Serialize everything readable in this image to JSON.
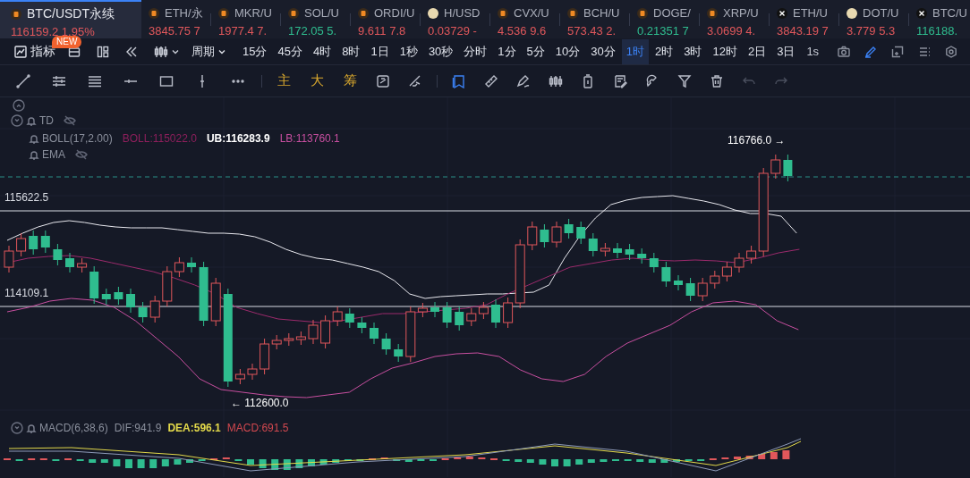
{
  "tabs": [
    {
      "symbol": "BTC/USDT永续",
      "quote": "116159.2 1.95%",
      "color": "#e0575b",
      "kind": "coin",
      "selected": true
    },
    {
      "symbol": "ETH/永",
      "quote": "3845.75 7",
      "color": "#e0575b",
      "kind": "coin",
      "selected": false
    },
    {
      "symbol": "MKR/U",
      "quote": "1977.4 7.",
      "color": "#e0575b",
      "kind": "coin",
      "selected": false
    },
    {
      "symbol": "SOL/U",
      "quote": "172.05 5.",
      "color": "#2fbd8f",
      "kind": "coin",
      "selected": false
    },
    {
      "symbol": "ORDI/U",
      "quote": "9.611 7.8",
      "color": "#e0575b",
      "kind": "coin",
      "selected": false
    },
    {
      "symbol": "H/USD",
      "quote": "0.03729 -",
      "color": "#e0575b",
      "kind": "light",
      "selected": false
    },
    {
      "symbol": "CVX/U",
      "quote": "4.536 9.6",
      "color": "#e0575b",
      "kind": "coin",
      "selected": false
    },
    {
      "symbol": "BCH/U",
      "quote": "573.43 2.",
      "color": "#e0575b",
      "kind": "coin",
      "selected": false
    },
    {
      "symbol": "DOGE/",
      "quote": "0.21351 7",
      "color": "#2fbd8f",
      "kind": "coin",
      "selected": false
    },
    {
      "symbol": "XRP/U",
      "quote": "3.0699 4.",
      "color": "#e0575b",
      "kind": "coin",
      "selected": false
    },
    {
      "symbol": "ETH/U",
      "quote": "3843.19 7",
      "color": "#e0575b",
      "kind": "cross",
      "selected": false
    },
    {
      "symbol": "DOT/U",
      "quote": "3.779 5.3",
      "color": "#e0575b",
      "kind": "light",
      "selected": false
    },
    {
      "symbol": "BTC/U",
      "quote": "116188.",
      "color": "#2fbd8f",
      "kind": "cross",
      "selected": false
    }
  ],
  "toolbar": {
    "indicator_button": "指标",
    "new_badge": "NEW",
    "period_menu": "周期",
    "periods": [
      {
        "label": "15分",
        "selected": false
      },
      {
        "label": "45分",
        "selected": false
      },
      {
        "label": "4时",
        "selected": false
      },
      {
        "label": "8时",
        "selected": false
      },
      {
        "label": "1日",
        "selected": false
      },
      {
        "label": "1秒",
        "selected": false
      },
      {
        "label": "30秒",
        "selected": false
      },
      {
        "label": "分时",
        "selected": false
      },
      {
        "label": "1分",
        "selected": false
      },
      {
        "label": "5分",
        "selected": false
      },
      {
        "label": "10分",
        "selected": false
      },
      {
        "label": "30分",
        "selected": false
      },
      {
        "label": "1时",
        "selected": true
      },
      {
        "label": "2时",
        "selected": false
      },
      {
        "label": "3时",
        "selected": false
      },
      {
        "label": "12时",
        "selected": false
      },
      {
        "label": "2日",
        "selected": false
      },
      {
        "label": "3日",
        "selected": false
      }
    ],
    "interval_label": "1s",
    "pencil_active": true
  },
  "drawing_tools": {
    "text_tools": [
      "主",
      "大",
      "筹"
    ],
    "undo_disabled": true,
    "redo_disabled": true
  },
  "legend": {
    "td": "TD",
    "boll": "BOLL(17,2.00)",
    "boll_value": "BOLL:115022.0",
    "ub": "UB:116283.9",
    "lb": "LB:113760.1",
    "ema": "EMA"
  },
  "price_labels": {
    "high": "116766.0 →",
    "low": "← 112600.0",
    "level_1": "115622.5",
    "level_2": "114109.1"
  },
  "macd": {
    "name": "MACD(6,38,6)",
    "dif": "DIF:941.9",
    "dea": "DEA:596.1",
    "macd": "MACD:691.5"
  }
}
